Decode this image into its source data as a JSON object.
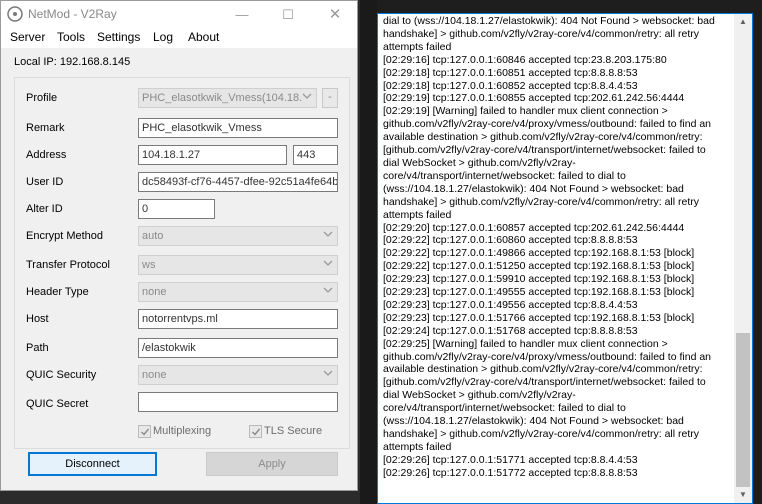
{
  "window": {
    "title": "NetMod - V2Ray",
    "minimize_glyph": "—",
    "maximize_glyph": "☐",
    "close_glyph": "✕"
  },
  "menu": [
    "Server",
    "Tools",
    "Settings",
    "Log",
    "About"
  ],
  "local_ip": "Local IP: 192.168.8.145",
  "form": {
    "profile_label": "Profile",
    "profile_value": "PHC_elasotkwik_Vmess(104.18.",
    "profile_minus": "-",
    "remark_label": "Remark",
    "remark_value": "PHC_elasotkwik_Vmess",
    "address_label": "Address",
    "address_value": "104.18.1.27",
    "port_value": "443",
    "userid_label": "User ID",
    "userid_value": "dc58493f-cf76-4457-dfee-92c51a4fe64b",
    "alterid_label": "Alter ID",
    "alterid_value": "0",
    "encrypt_label": "Encrypt Method",
    "encrypt_value": "auto",
    "transfer_label": "Transfer Protocol",
    "transfer_value": "ws",
    "header_label": "Header Type",
    "header_value": "none",
    "host_label": "Host",
    "host_value": "notorrentvps.ml",
    "path_label": "Path",
    "path_value": "/elastokwik",
    "quic_security_label": "QUIC Security",
    "quic_security_value": "none",
    "quic_secret_label": "QUIC Secret",
    "quic_secret_value": "",
    "multiplexing_label": "Multiplexing",
    "multiplexing_checked": true,
    "tls_label": "TLS Secure",
    "tls_checked": true
  },
  "buttons": {
    "disconnect": "Disconnect",
    "apply": "Apply"
  },
  "log": [
    "dial to (wss://104.18.1.27/elastokwik): 404 Not Found > websocket: bad handshake] > github.com/v2fly/v2ray-core/v4/common/retry: all retry attempts failed",
    "[02:29:16]  tcp:127.0.0.1:60846 accepted tcp:23.8.203.175:80",
    "[02:29:18]  tcp:127.0.0.1:60851 accepted tcp:8.8.8.8:53",
    "[02:29:18]  tcp:127.0.0.1:60852 accepted tcp:8.8.4.4:53",
    "[02:29:19]  tcp:127.0.0.1:60855 accepted tcp:202.61.242.56:4444",
    "[02:29:19]  [Warning] failed to handler mux client connection > github.com/v2fly/v2ray-core/v4/proxy/vmess/outbound: failed to find an available destination > github.com/v2fly/v2ray-core/v4/common/retry: [github.com/v2fly/v2ray-core/v4/transport/internet/websocket: failed to dial WebSocket > github.com/v2fly/v2ray-core/v4/transport/internet/websocket: failed to dial to (wss://104.18.1.27/elastokwik): 404 Not Found > websocket: bad handshake] > github.com/v2fly/v2ray-core/v4/common/retry: all retry attempts failed",
    "[02:29:20]  tcp:127.0.0.1:60857 accepted tcp:202.61.242.56:4444",
    "[02:29:22]  tcp:127.0.0.1:60860 accepted tcp:8.8.8.8:53",
    "[02:29:22]  tcp:127.0.0.1:49866 accepted tcp:192.168.8.1:53 [block]",
    "[02:29:22]  tcp:127.0.0.1:51250 accepted tcp:192.168.8.1:53 [block]",
    "[02:29:23]  tcp:127.0.0.1:59910 accepted tcp:192.168.8.1:53 [block]",
    "[02:29:23]  tcp:127.0.0.1:49555 accepted tcp:192.168.8.1:53 [block]",
    "[02:29:23]  tcp:127.0.0.1:49556 accepted tcp:8.8.4.4:53",
    "[02:29:23]  tcp:127.0.0.1:51766 accepted tcp:192.168.8.1:53 [block]",
    "[02:29:24]  tcp:127.0.0.1:51768 accepted tcp:8.8.8.8:53",
    "[02:29:25]  [Warning] failed to handler mux client connection > github.com/v2fly/v2ray-core/v4/proxy/vmess/outbound: failed to find an available destination > github.com/v2fly/v2ray-core/v4/common/retry: [github.com/v2fly/v2ray-core/v4/transport/internet/websocket: failed to dial WebSocket > github.com/v2fly/v2ray-core/v4/transport/internet/websocket: failed to dial to (wss://104.18.1.27/elastokwik): 404 Not Found > websocket: bad handshake] > github.com/v2fly/v2ray-core/v4/common/retry: all retry attempts failed",
    "[02:29:26]  tcp:127.0.0.1:51771 accepted tcp:8.8.4.4:53",
    "[02:29:26]  tcp:127.0.0.1:51772 accepted tcp:8.8.8.8:53"
  ],
  "colors": {
    "accent": "#0078d7",
    "window_bg": "#f0f0f0",
    "desktop_bg": "#1e1e1e"
  }
}
